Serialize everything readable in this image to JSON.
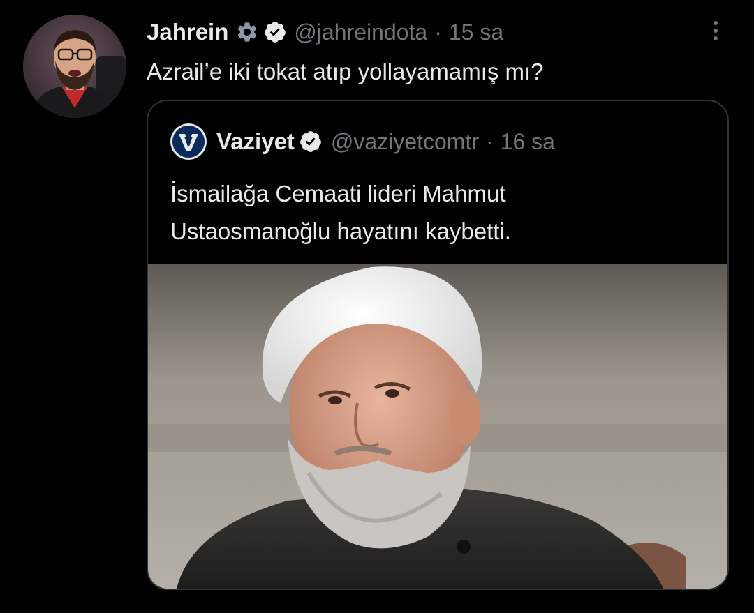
{
  "tweet": {
    "display_name": "Jahrein",
    "handle": "@jahreindota",
    "separator": "·",
    "time": "15 sa",
    "text": "Azrail’e iki tokat atıp yollayamamış mı?"
  },
  "quoted_tweet": {
    "display_name": "Vaziyet",
    "handle": "@vaziyetcomtr",
    "separator": "·",
    "time": "16 sa",
    "text_line1": "İsmailağa Cemaati lideri Mahmut",
    "text_line2": "Ustaosmanoğlu hayatını kaybetti."
  },
  "icons": {
    "gear": "gear-icon",
    "verified": "verified-badge-icon",
    "more": "more-options-icon",
    "vaziyet_logo": "vaziyet-logo"
  },
  "colors": {
    "background": "#000000",
    "text_primary": "#e7e9ea",
    "text_secondary": "#71767b",
    "card_border": "#2f3336",
    "vaziyet_brand": "#0b2a5b"
  }
}
